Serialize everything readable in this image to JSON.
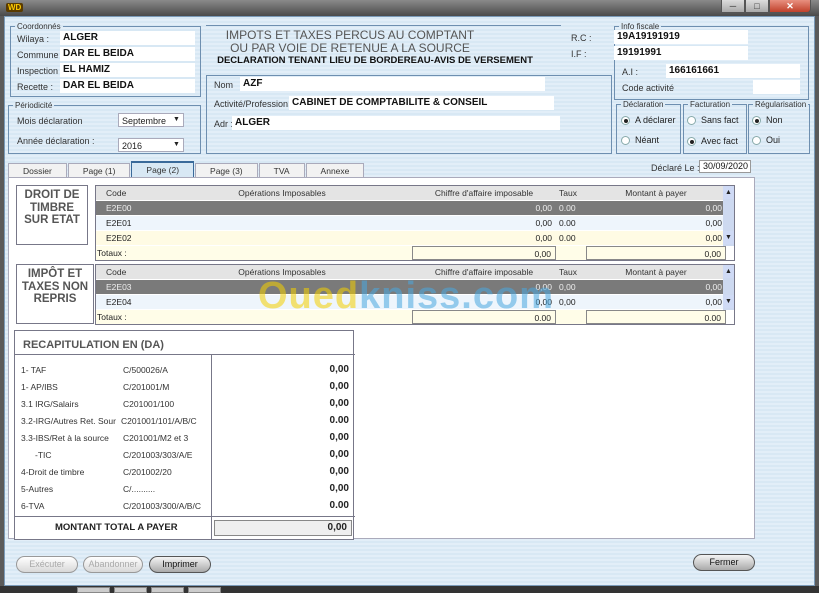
{
  "window": {
    "app_icon": "WD",
    "title_controls": [
      "minimize",
      "maximize",
      "close"
    ]
  },
  "coordonnees": {
    "legend": "Coordonnés",
    "fields": [
      {
        "label": "Wilaya :",
        "value": "ALGER"
      },
      {
        "label": "Commune :",
        "value": "DAR EL BEIDA"
      },
      {
        "label": "Inspection :",
        "value": "EL HAMIZ"
      },
      {
        "label": "Recette :",
        "value": "DAR EL BEIDA"
      }
    ]
  },
  "header": {
    "line1": "IMPOTS ET TAXES PERCUS AU COMPTANT",
    "line2": "OU PAR VOIE DE RETENUE A LA SOURCE",
    "line3": "DECLARATION TENANT LIEU DE BORDEREAU-AVIS DE VERSEMENT"
  },
  "info_fiscale": {
    "legend": "Info fiscale",
    "rc_label": "R.C :",
    "rc_value": "19A19191919",
    "if_label": "I.F :",
    "if_value": "19191991",
    "ai_label": "A.I :",
    "ai_value": "166161661",
    "code_activite_label": "Code activité",
    "code_activite_value": ""
  },
  "identite": {
    "nom_label": "Nom",
    "nom_value": "AZF",
    "activite_label": "Activité/Profession :",
    "activite_value": "CABINET DE COMPTABILITE & CONSEIL",
    "adr_label": "Adr :",
    "adr_value": "ALGER"
  },
  "periodicite": {
    "legend": "Périodicité",
    "mois_label": "Mois déclaration",
    "mois_value": "Septembre",
    "annee_label": "Année déclaration :",
    "annee_value": "2016"
  },
  "declaration": {
    "legend": "Déclaration",
    "options": [
      "A déclarer",
      "Néant"
    ],
    "selected": "A déclarer"
  },
  "facturation": {
    "legend": "Facturation",
    "options": [
      "Sans fact",
      "Avec fact"
    ],
    "selected": "Avec fact"
  },
  "regularisation": {
    "legend": "Régularisation",
    "options": [
      "Non",
      "Oui"
    ],
    "selected": "Non"
  },
  "declare_le": {
    "label": "Déclaré Le :",
    "value": "30/09/2020"
  },
  "tabs": [
    {
      "label": "Dossier",
      "active": false
    },
    {
      "label": "Page (1)",
      "active": false
    },
    {
      "label": "Page (2)",
      "active": true
    },
    {
      "label": "Page (3)",
      "active": false
    },
    {
      "label": "TVA",
      "active": false
    },
    {
      "label": "Annexe",
      "active": false
    }
  ],
  "columns": {
    "code": "Code",
    "operations": "Opérations Imposables",
    "chiffre": "Chiffre d'affaire imposable",
    "taux": "Taux",
    "montant": "Montant à payer"
  },
  "droit_timbre": {
    "title": "DROIT DE TIMBRE SUR ETAT",
    "rows": [
      {
        "code": "E2E00",
        "operation": "",
        "chiffre": "0,00",
        "taux": "0.00",
        "montant": "0,00"
      },
      {
        "code": "E2E01",
        "operation": "",
        "chiffre": "0,00",
        "taux": "0.00",
        "montant": "0,00"
      },
      {
        "code": "E2E02",
        "operation": "",
        "chiffre": "0,00",
        "taux": "0.00",
        "montant": "0,00"
      }
    ],
    "totaux_label": "Totaux :",
    "total_chiffre": "0,00",
    "total_montant": "0,00"
  },
  "impot_non_repris": {
    "title": "IMPÔT ET TAXES NON REPRIS",
    "rows": [
      {
        "code": "E2E03",
        "operation": "",
        "chiffre": "0,00",
        "taux": "0,00",
        "montant": "0,00"
      },
      {
        "code": "E2E04",
        "operation": "",
        "chiffre": "0,00",
        "taux": "0,00",
        "montant": "0,00"
      }
    ],
    "totaux_label": "Totaux :",
    "total_chiffre": "0.00",
    "total_montant": "0.00"
  },
  "recap": {
    "title": "RECAPITULATION EN (DA)",
    "rows": [
      {
        "name": "1- TAF",
        "code": "C/500026/A",
        "amount": "0,00"
      },
      {
        "name": "1- AP/IBS",
        "code": "C/201001/M",
        "amount": "0,00"
      },
      {
        "name": "3.1 IRG/Salairs",
        "code": "C201001/100",
        "amount": "0,00"
      },
      {
        "name": "3.2-IRG/Autres Ret. Sour",
        "code": "C201001/101/A/B/C",
        "amount": "0.00"
      },
      {
        "name": "3.3-IBS/Ret à la source",
        "code": "C201001/M2 et 3",
        "amount": "0,00"
      },
      {
        "name": "-TIC",
        "code": "C/201003/303/A/E",
        "amount": "0,00"
      },
      {
        "name": "4-Droit de timbre",
        "code": "C/201002/20",
        "amount": "0,00"
      },
      {
        "name": "5-Autres",
        "code": "C/..........",
        "amount": "0,00"
      },
      {
        "name": "6-TVA",
        "code": "C/201003/300/A/B/C",
        "amount": "0.00"
      }
    ],
    "total_label": "MONTANT TOTAL A PAYER",
    "total_value": "0,00"
  },
  "buttons": {
    "executer": "Exécuter",
    "abandonner": "Abandonner",
    "imprimer": "Imprimer",
    "fermer": "Fermer"
  },
  "watermark": {
    "part1": "Oued",
    "part2": "kniss.com",
    "color1": "#f5d000",
    "color2": "#4aa8e0"
  }
}
